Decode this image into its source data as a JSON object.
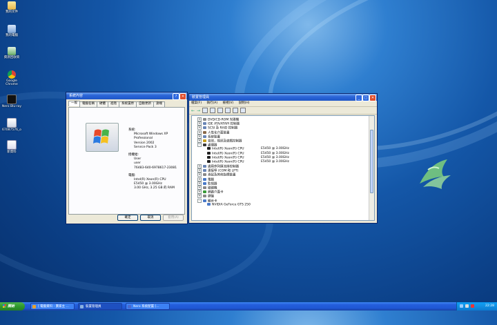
{
  "desktop_icons": [
    {
      "label": "我的文件",
      "icon": "my-documents-icon"
    },
    {
      "label": "我的電腦",
      "icon": "my-computer-icon"
    },
    {
      "label": "資源回收筒",
      "icon": "recycle-bin-icon"
    },
    {
      "label": "Google Chrome",
      "icon": "chrome-icon"
    },
    {
      "label": "Nero Blu-ray",
      "icon": "nero-icon"
    },
    {
      "label": "67087576_o",
      "icon": "image-file-icon"
    },
    {
      "label": "新資料",
      "icon": "document-icon"
    }
  ],
  "sysprop": {
    "title": "系統內容",
    "tabs": [
      "一般",
      "電腦名稱",
      "硬體",
      "進階",
      "系統還原",
      "自動更新",
      "遠端"
    ],
    "system_heading": "系統:",
    "system": [
      "Microsoft Windows XP",
      "Professional",
      "Version 2002",
      "Service Pack 3"
    ],
    "registered_heading": "授權給:",
    "registered": [
      "User",
      "user",
      "76483-640-6978617-23081"
    ],
    "computer_heading": "電腦:",
    "computer": [
      "Intel(R) Xeon(R) CPU",
      "E5450  @ 3.00GHz",
      "3.00 GHz, 3.25 GB 的 RAM"
    ],
    "buttons": {
      "ok": "確定",
      "cancel": "取消",
      "apply": "套用(A)"
    }
  },
  "devmgr": {
    "title": "裝置管理員",
    "menu": [
      "檔案(F)",
      "執行(A)",
      "檢視(V)",
      "說明(H)"
    ],
    "items": [
      {
        "expander": "+",
        "label": "DVD/CD-ROM 光碟機",
        "color": "#8a8a8a"
      },
      {
        "expander": "+",
        "label": "IDE ATA/ATAPI 控制器",
        "color": "#6a86b5"
      },
      {
        "expander": "+",
        "label": "SCSI 及 RAID 控制器",
        "color": "#6a86b5"
      },
      {
        "expander": "+",
        "label": "人性化介面裝置",
        "color": "#8a6a4a"
      },
      {
        "expander": "+",
        "label": "系統裝置",
        "color": "#6a86b5"
      },
      {
        "expander": "+",
        "label": "音效，視訊及遊戲控制器",
        "color": "#c8a020"
      },
      {
        "expander": "-",
        "label": "處理器",
        "color": "#3a3a3a"
      },
      {
        "child": true,
        "label": "Intel(R) Xeon(R) CPU",
        "spec": "E5450  @ 3.00GHz",
        "color": "#222"
      },
      {
        "child": true,
        "label": "Intel(R) Xeon(R) CPU",
        "spec": "E5450  @ 3.00GHz",
        "color": "#222"
      },
      {
        "child": true,
        "label": "Intel(R) Xeon(R) CPU",
        "spec": "E5450  @ 3.00GHz",
        "color": "#222"
      },
      {
        "child": true,
        "label": "Intel(R) Xeon(R) CPU",
        "spec": "E5450  @ 3.00GHz",
        "color": "#222"
      },
      {
        "expander": "+",
        "label": "通用序列匯流排控制器",
        "color": "#6a86b5"
      },
      {
        "expander": "+",
        "label": "連接埠 (COM 和 LPT)",
        "color": "#6a86b5"
      },
      {
        "expander": "+",
        "label": "滑鼠及其他指標裝置",
        "color": "#888"
      },
      {
        "expander": "+",
        "label": "電腦",
        "color": "#4a7ac8"
      },
      {
        "expander": "+",
        "label": "監視器",
        "color": "#4a7ac8"
      },
      {
        "expander": "+",
        "label": "磁碟機",
        "color": "#888"
      },
      {
        "expander": "+",
        "label": "網路介面卡",
        "color": "#3a9a3a"
      },
      {
        "expander": "+",
        "label": "鍵盤",
        "color": "#888"
      },
      {
        "expander": "-",
        "label": "顯示卡",
        "color": "#4a7ac8"
      },
      {
        "child": true,
        "label": "NVIDIA GeForce GTS 250",
        "spec": "",
        "color": "#4a7ac8"
      }
    ]
  },
  "taskbar": {
    "start": "開始",
    "tasks": [
      {
        "label": "[ 電腦資料 - 賣家主 ...",
        "color": "#e8a030"
      },
      {
        "label": "裝置管理員",
        "color": "#8ab0e0"
      },
      {
        "label": "Nero 系統配置 [...",
        "color": "#4a6ad0"
      }
    ],
    "clock": "22:28"
  },
  "colors": {
    "accent": "#245edb",
    "titlebar": "#2c66d8",
    "start": "#2f9b2e"
  }
}
